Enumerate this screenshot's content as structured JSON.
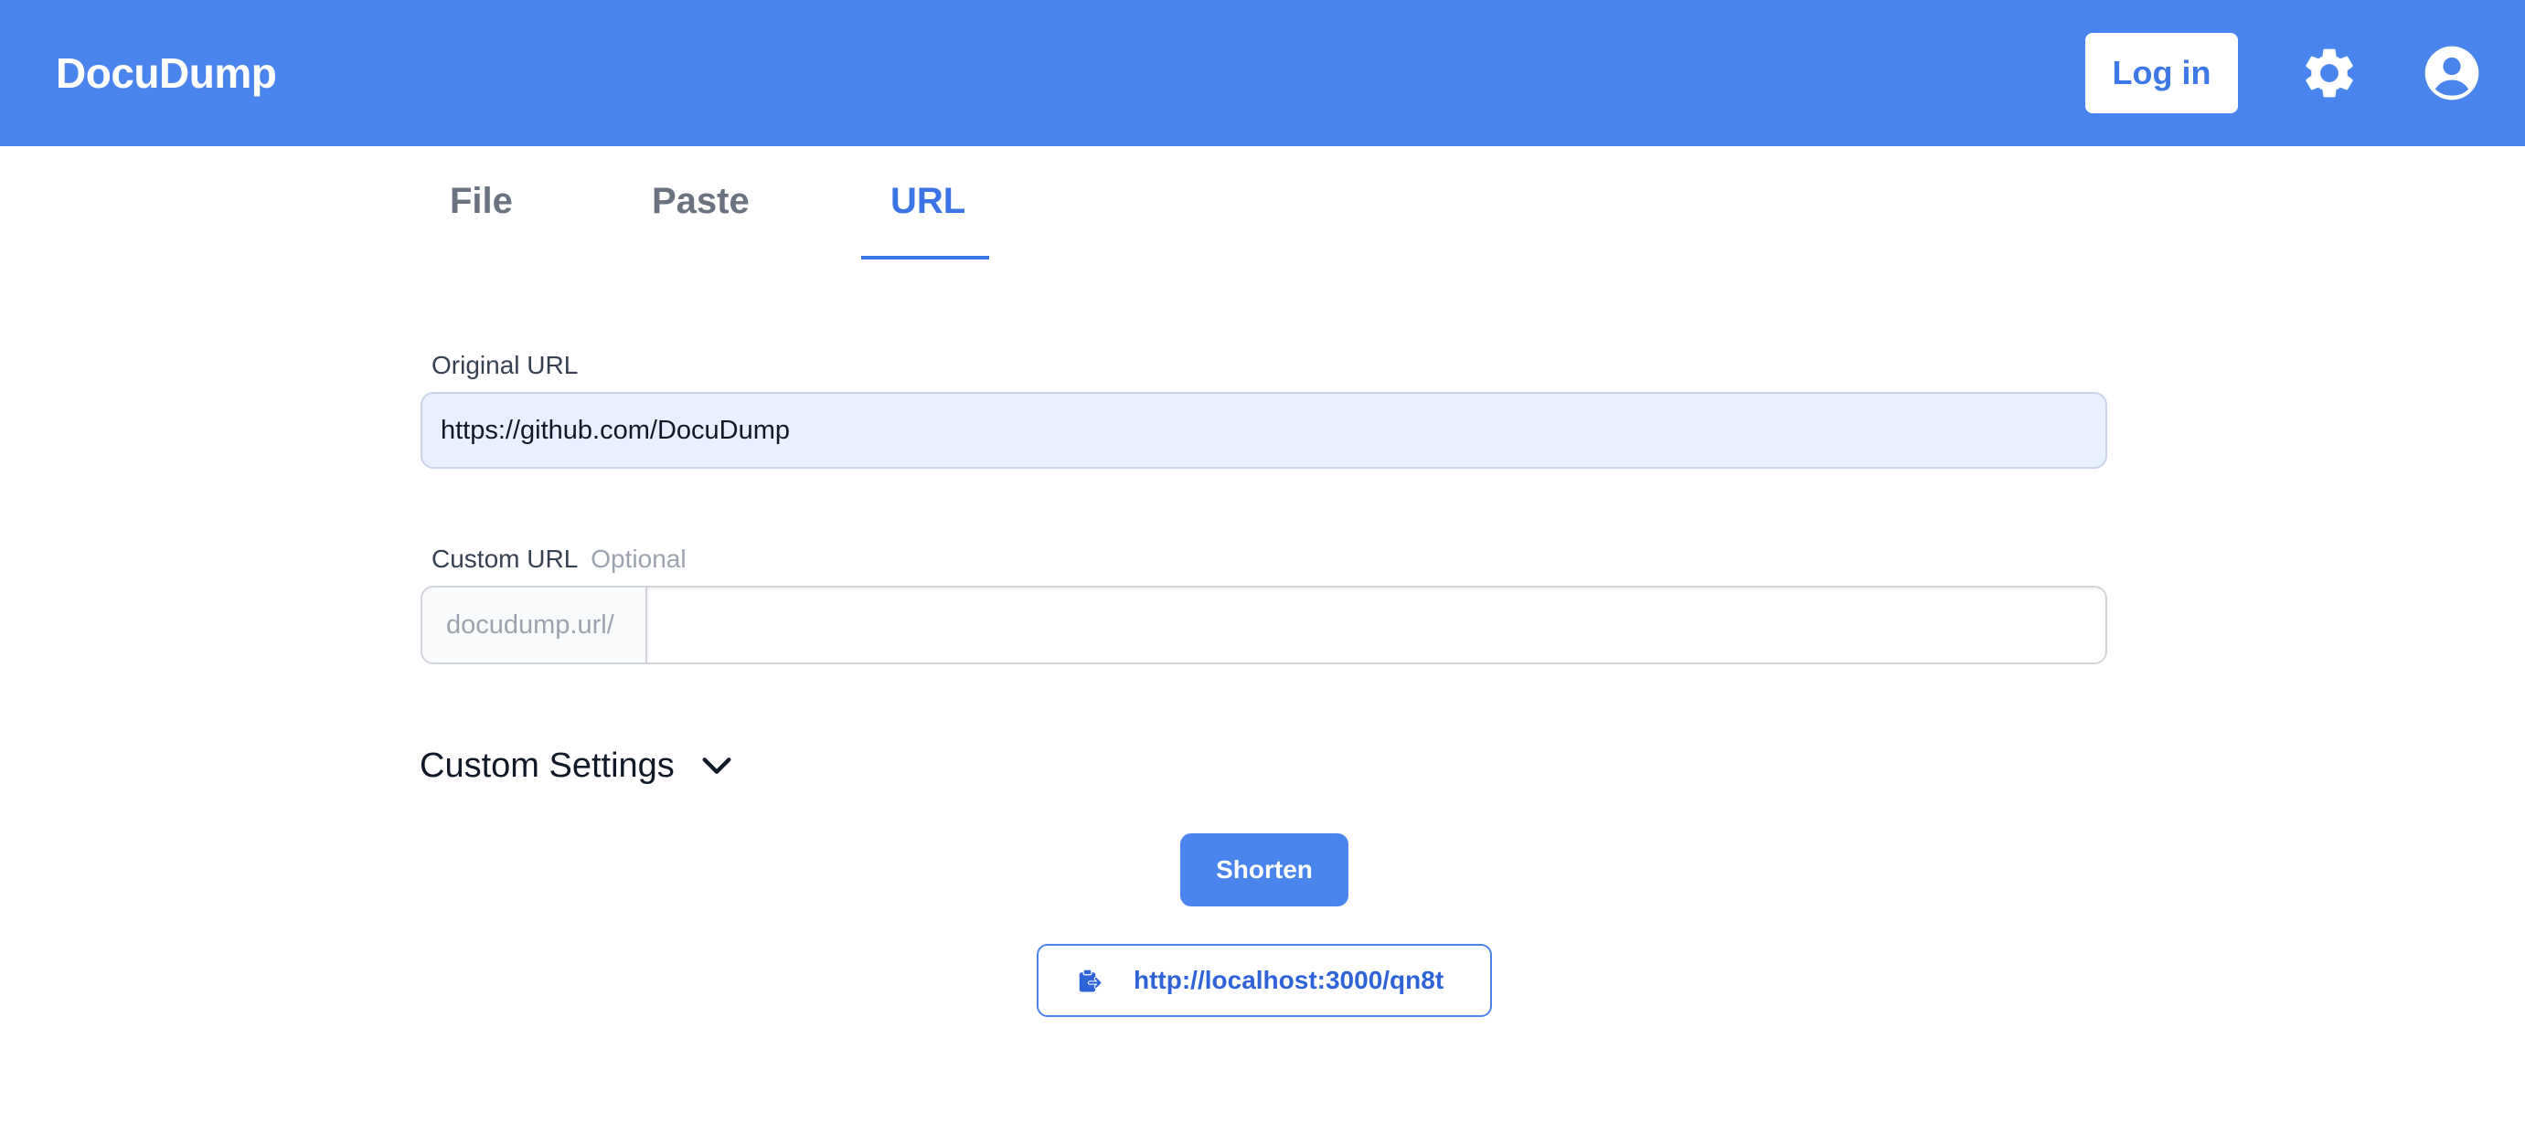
{
  "header": {
    "brand": "DocuDump",
    "login_label": "Log in",
    "icons": [
      "gear-icon",
      "user-circle-icon"
    ],
    "background_color": "#4a84ed"
  },
  "tabs": [
    {
      "label": "File",
      "active": false
    },
    {
      "label": "Paste",
      "active": false
    },
    {
      "label": "URL",
      "active": true
    }
  ],
  "form": {
    "original_url": {
      "label": "Original URL",
      "value": "https://github.com/DocuDump"
    },
    "custom_url": {
      "label": "Custom URL",
      "optional_label": "Optional",
      "prefix": "docudump.url/",
      "value": ""
    },
    "custom_settings_label": "Custom Settings",
    "submit_label": "Shorten"
  },
  "result": {
    "icon": "clipboard-icon",
    "url": "http://localhost:3000/qn8t"
  },
  "colors": {
    "accent": "#4a84ed",
    "active_tab": "#3b74e4",
    "link": "#2f63d8"
  }
}
